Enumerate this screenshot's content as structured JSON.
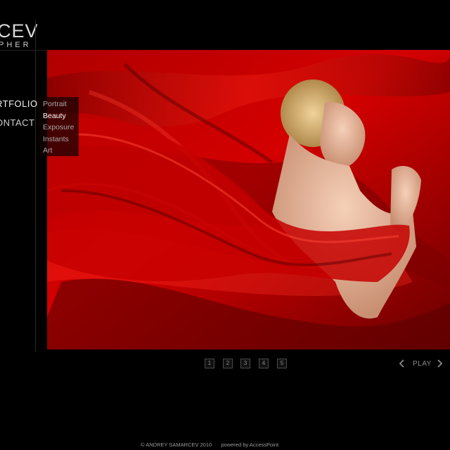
{
  "logo": {
    "line1": "CEV",
    "line2": "PHER"
  },
  "nav": {
    "portfolio": "RTFOLIO",
    "contact": "ONTACT"
  },
  "submenu": {
    "items": [
      "Portrait",
      "Beauty",
      "Exposure",
      "Instants",
      "Art"
    ],
    "active": "Beauty"
  },
  "pager": {
    "pages": [
      "1",
      "2",
      "3",
      "4",
      "5"
    ]
  },
  "slideshow": {
    "play_label": "PLAY"
  },
  "footer": {
    "copyright": "© ANDREY SAMARCEV 2010",
    "powered_prefix": "powered by",
    "powered_link": "AccessPoint"
  },
  "colors": {
    "background": "#000000",
    "accent_red": "#c00000"
  }
}
